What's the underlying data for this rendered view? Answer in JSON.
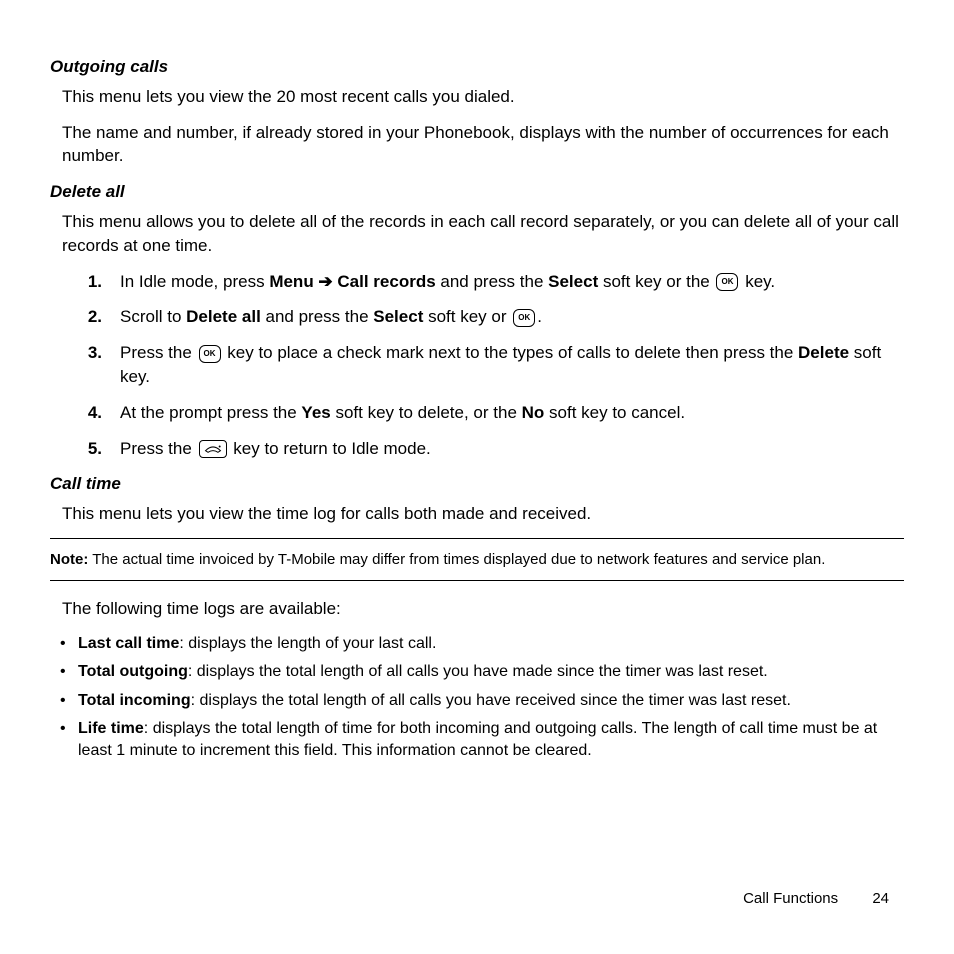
{
  "h1": "Outgoing calls",
  "p1": "This menu lets you view the 20 most recent calls you dialed.",
  "p2": "The name and number, if already stored in your Phonebook, displays with the number of occurrences for each number.",
  "h2": "Delete all",
  "p3": "This menu allows you to delete all of the records in each call record separately, or you can delete all of your call records at one time.",
  "ol": {
    "n1": "1.",
    "t1a": "In Idle mode, press ",
    "t1b": "Menu",
    "t1arrow": " ➔ ",
    "t1c": "Call records",
    "t1d": " and press the ",
    "t1e": "Select",
    "t1f": " soft key or the ",
    "t1g": " key.",
    "n2": "2.",
    "t2a": "Scroll to ",
    "t2b": "Delete all",
    "t2c": " and press the ",
    "t2d": "Select",
    "t2e": " soft key or ",
    "t2f": ".",
    "n3": "3.",
    "t3a": "Press the ",
    "t3b": " key to place a check mark next to the types of calls to delete then press the ",
    "t3c": "Delete",
    "t3d": " soft key.",
    "n4": "4.",
    "t4a": "At the prompt press the ",
    "t4b": "Yes",
    "t4c": " soft key to delete, or the ",
    "t4d": "No",
    "t4e": " soft key to cancel.",
    "n5": "5.",
    "t5a": "Press the ",
    "t5b": " key to return to Idle mode."
  },
  "ok_label": "OK",
  "h3": "Call time",
  "p4": "This menu lets you view the time log for calls both made and received.",
  "note_label": "Note:",
  "note_text": " The actual time invoiced by T-Mobile may differ from times displayed due to network features and service plan.",
  "p5": "The following time logs are available:",
  "ul": {
    "b1": "Last call time",
    "t1": ": displays the length of your last call.",
    "b2": "Total outgoing",
    "t2": ": displays the total length of all calls you have made since the timer was last reset.",
    "b3": "Total incoming",
    "t3": ": displays the total length of all calls you have received since the timer was last reset.",
    "b4": "Life time",
    "t4": ": displays the total length of time for both incoming and outgoing calls. The length of call time must be at least 1 minute to increment this field. This information cannot be cleared."
  },
  "footer_section": "Call Functions",
  "footer_page": "24"
}
